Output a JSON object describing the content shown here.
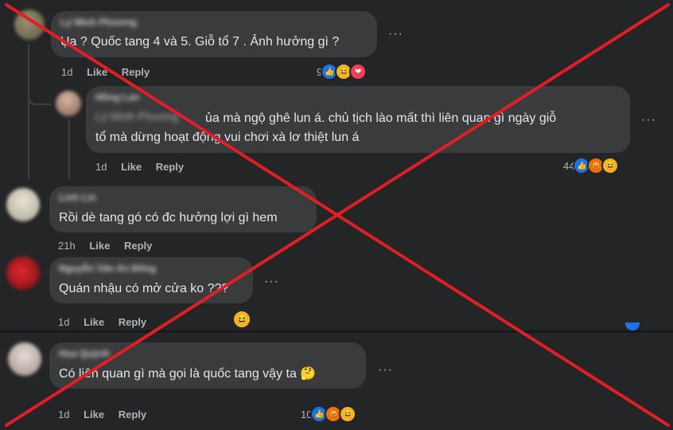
{
  "comments": [
    {
      "name": "Lý Minh Phương",
      "text": "Ụa ? Quốc tang 4 và 5. Giỗ tổ 7 . Ảnh hưởng gì ?",
      "time": "1d",
      "like": "Like",
      "reply": "Reply",
      "reaction_count": "9",
      "reactions": [
        "like",
        "haha",
        "love"
      ]
    },
    {
      "name": "Hồng Lan",
      "reply_to": "Lý Minh Phương",
      "text_line1": "ủa mà ngộ ghê lun á. chủ tịch lào mất thì liên quan gì ngày giỗ",
      "text_line2": "tổ mà dừng hoạt động vui chơi xà lơ thiệt lun á",
      "time": "1d",
      "like": "Like",
      "reply": "Reply",
      "reaction_count": "44",
      "reactions": [
        "like",
        "angry",
        "haha"
      ]
    },
    {
      "name": "Linh Lin",
      "text": "Rồi dè tang gó có đc hưởng lợi gì hem",
      "time": "21h",
      "like": "Like",
      "reply": "Reply"
    },
    {
      "name": "Nguyễn Văn An Đông",
      "text": "Quán nhậu có mở cửa ko ???",
      "time": "1d",
      "like": "Like",
      "reply": "Reply",
      "reactions": [
        "haha"
      ]
    },
    {
      "name": "Hoa Quỳnh",
      "text": "Có liên quan gì mà gọi là quốc tang vậy ta 🤔",
      "time": "1d",
      "like": "Like",
      "reply": "Reply",
      "reaction_count": "10",
      "reactions": [
        "like",
        "angry",
        "haha"
      ]
    }
  ],
  "icons": {
    "more": "more-options-icon",
    "like": "👍",
    "haha": "😆",
    "love": "❤",
    "angry": "😡"
  },
  "colors": {
    "background": "#242526",
    "bubble": "#3a3b3c",
    "cross": "#e01e24"
  }
}
